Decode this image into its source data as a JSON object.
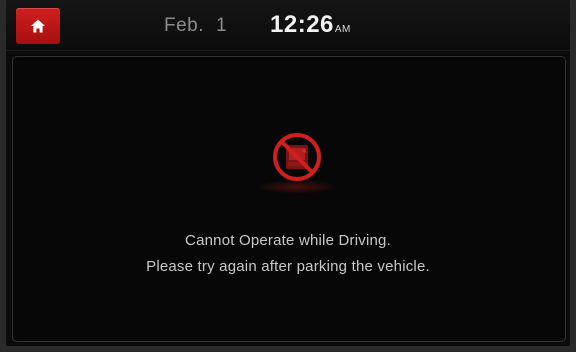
{
  "statusbar": {
    "home_icon": "home-icon",
    "date_month": "Feb.",
    "date_day": "1",
    "time": "12:26",
    "ampm": "AM",
    "accent_color": "#c41414"
  },
  "message": {
    "icon": "no-operation-while-driving-icon",
    "line1": "Cannot Operate while Driving.",
    "line2": "Please try again after parking the vehicle."
  }
}
